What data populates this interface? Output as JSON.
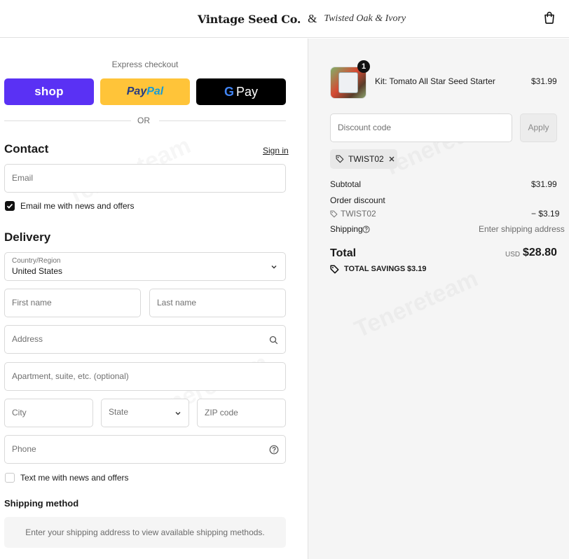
{
  "header": {
    "logo_primary": "Vintage Seed Co.",
    "logo_amp": "&",
    "logo_secondary": "Twisted Oak & Ivory",
    "cart_icon": "shopping-bag-icon"
  },
  "express": {
    "title": "Express checkout",
    "shop_label": "shop",
    "paypal_pay": "Pay",
    "paypal_pal": "Pal",
    "gpay_g": "G",
    "gpay_label": "Pay",
    "or_label": "OR"
  },
  "contact": {
    "title": "Contact",
    "signin": "Sign in",
    "email_placeholder": "Email",
    "newsletter_label": "Email me with news and offers",
    "newsletter_checked": true
  },
  "delivery": {
    "title": "Delivery",
    "country_label": "Country/Region",
    "country_value": "United States",
    "first_name_placeholder": "First name",
    "last_name_placeholder": "Last name",
    "address_placeholder": "Address",
    "apartment_placeholder": "Apartment, suite, etc. (optional)",
    "city_placeholder": "City",
    "state_placeholder": "State",
    "zip_placeholder": "ZIP code",
    "phone_placeholder": "Phone",
    "sms_label": "Text me with news and offers",
    "sms_checked": false
  },
  "shipping_method": {
    "title": "Shipping method",
    "message": "Enter your shipping address to view available shipping methods."
  },
  "summary": {
    "item": {
      "quantity": "1",
      "name": "Kit: Tomato All Star Seed Starter",
      "price": "$31.99"
    },
    "discount_placeholder": "Discount code",
    "apply_label": "Apply",
    "applied_code": "TWIST02",
    "subtotal_label": "Subtotal",
    "subtotal_value": "$31.99",
    "order_discount_label": "Order discount",
    "discount_code": "TWIST02",
    "discount_value": "− $3.19",
    "shipping_label": "Shipping",
    "shipping_value": "Enter shipping address",
    "total_label": "Total",
    "total_currency": "USD",
    "total_value": "$28.80",
    "savings_label": "TOTAL SAVINGS",
    "savings_value": "$3.19"
  },
  "watermark": "Tenereteam",
  "colors": {
    "shop": "#5a31f4",
    "paypal": "#ffc439",
    "gpay": "#000000",
    "summary_bg": "#f5f5f5"
  }
}
